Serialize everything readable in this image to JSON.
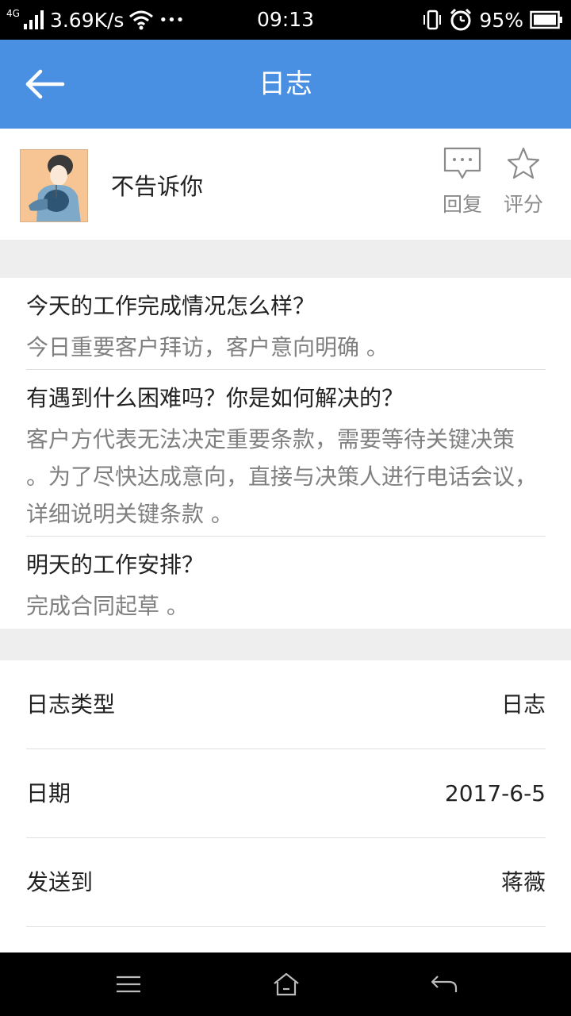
{
  "status_bar": {
    "network_type": "4G",
    "speed": "3.69K/s",
    "more": "•••",
    "time": "09:13",
    "battery": "95%"
  },
  "header": {
    "title": "日志",
    "back_icon": "back-arrow-icon"
  },
  "author": {
    "name": "不告诉你",
    "reply_label": "回复",
    "rate_label": "评分"
  },
  "qa": [
    {
      "question": "今天的工作完成情况怎么样？",
      "answer": "今日重要客户拜访，客户意向明确 。"
    },
    {
      "question": "有遇到什么困难吗？你是如何解决的？",
      "answer": "客户方代表无法决定重要条款，需要等待关键决策 。为了尽快达成意向，直接与决策人进行电话会议，详细说明关键条款 。"
    },
    {
      "question": "明天的工作安排？",
      "answer": "完成合同起草 。"
    }
  ],
  "info": [
    {
      "label": "日志类型",
      "value": "日志"
    },
    {
      "label": "日期",
      "value": "2017-6-5"
    },
    {
      "label": "发送到",
      "value": "蒋薇"
    }
  ],
  "colors": {
    "appbar": "#4a90e2",
    "section_gap": "#eeeeee",
    "answer_text": "#808080"
  }
}
